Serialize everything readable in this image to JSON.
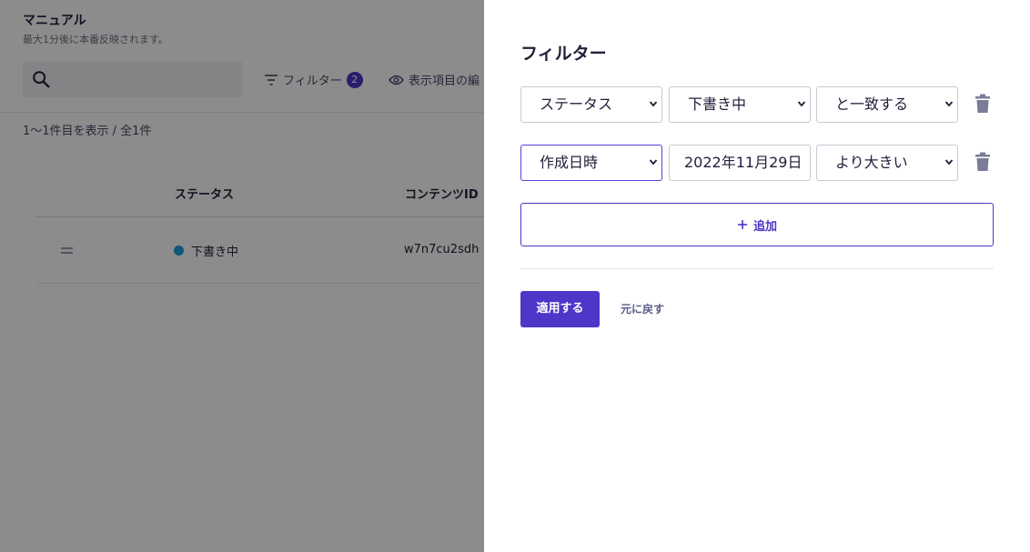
{
  "background": {
    "title": "マニュアル",
    "subtitle": "最大1分後に本番反映されます。",
    "search": {
      "placeholder": ""
    },
    "filter_button": {
      "label": "フィルター",
      "count": "2"
    },
    "display_button": {
      "label": "表示項目の編"
    },
    "result_count": "1〜1件目を表示 / 全1件",
    "table": {
      "columns": [
        "ステータス",
        "コンテンツID"
      ],
      "rows": [
        {
          "status": "下書き中",
          "status_color": "#1a9fd9",
          "id": "w7n7cu2sdh"
        }
      ]
    }
  },
  "panel": {
    "title": "フィルター",
    "filters": [
      {
        "field": "ステータス",
        "value": "下書き中",
        "operator": "と一致する"
      },
      {
        "field": "作成日時",
        "value": "2022年11月29日",
        "operator": "より大きい"
      }
    ],
    "add_label": "追加",
    "apply_label": "適用する",
    "revert_label": "元に戻す"
  },
  "colors": {
    "accent": "#4d36c8",
    "overlay": "rgba(0,0,0,0.45)"
  }
}
